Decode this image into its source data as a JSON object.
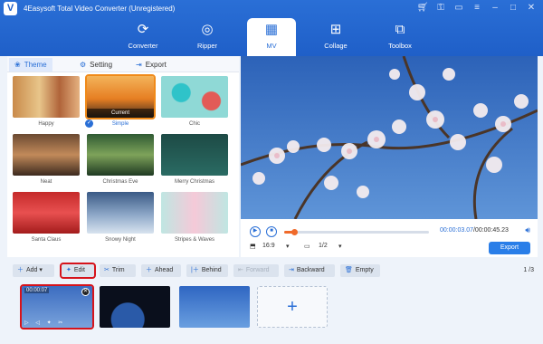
{
  "app": {
    "title": "4Easysoft Total Video Converter (Unregistered)",
    "logo": "V"
  },
  "window_controls": [
    "cart-icon",
    "key-icon",
    "chat-icon",
    "menu-icon",
    "minimize-icon",
    "maximize-icon",
    "close-icon"
  ],
  "nav": [
    {
      "label": "Converter",
      "icon": "⟳"
    },
    {
      "label": "Ripper",
      "icon": "◎"
    },
    {
      "label": "MV",
      "icon": "▦",
      "active": true
    },
    {
      "label": "Collage",
      "icon": "⊞"
    },
    {
      "label": "Toolbox",
      "icon": "⧉"
    }
  ],
  "sub_tabs": {
    "theme": "Theme",
    "setting": "Setting",
    "export": "Export"
  },
  "themes": [
    {
      "name": "Happy"
    },
    {
      "name": "Simple",
      "badge": "Current",
      "selected": true
    },
    {
      "name": "Chic"
    },
    {
      "name": "Neat"
    },
    {
      "name": "Christmas Eve"
    },
    {
      "name": "Merry Christmas"
    },
    {
      "name": "Santa Claus"
    },
    {
      "name": "Snowy Night"
    },
    {
      "name": "Stripes & Waves"
    }
  ],
  "player": {
    "current_time": "00:00:03.07",
    "total_time": "/00:00:45.23",
    "progress": 0.07,
    "aspect": "16:9",
    "page": "1/2",
    "export_label": "Export"
  },
  "toolbar": {
    "add": "Add",
    "edit": "Edit",
    "trim": "Trim",
    "ahead": "Ahead",
    "behind": "Behind",
    "forward": "Forward",
    "backward": "Backward",
    "empty": "Empty",
    "page_indicator": "1 /3"
  },
  "clips": [
    {
      "time": "00:00:07"
    },
    {
      "time": ""
    },
    {
      "time": ""
    }
  ],
  "colors": {
    "accent": "#2a6fd6",
    "selection": "#f08a1a",
    "highlight": "#d6131b",
    "progress": "#f06a2a"
  }
}
